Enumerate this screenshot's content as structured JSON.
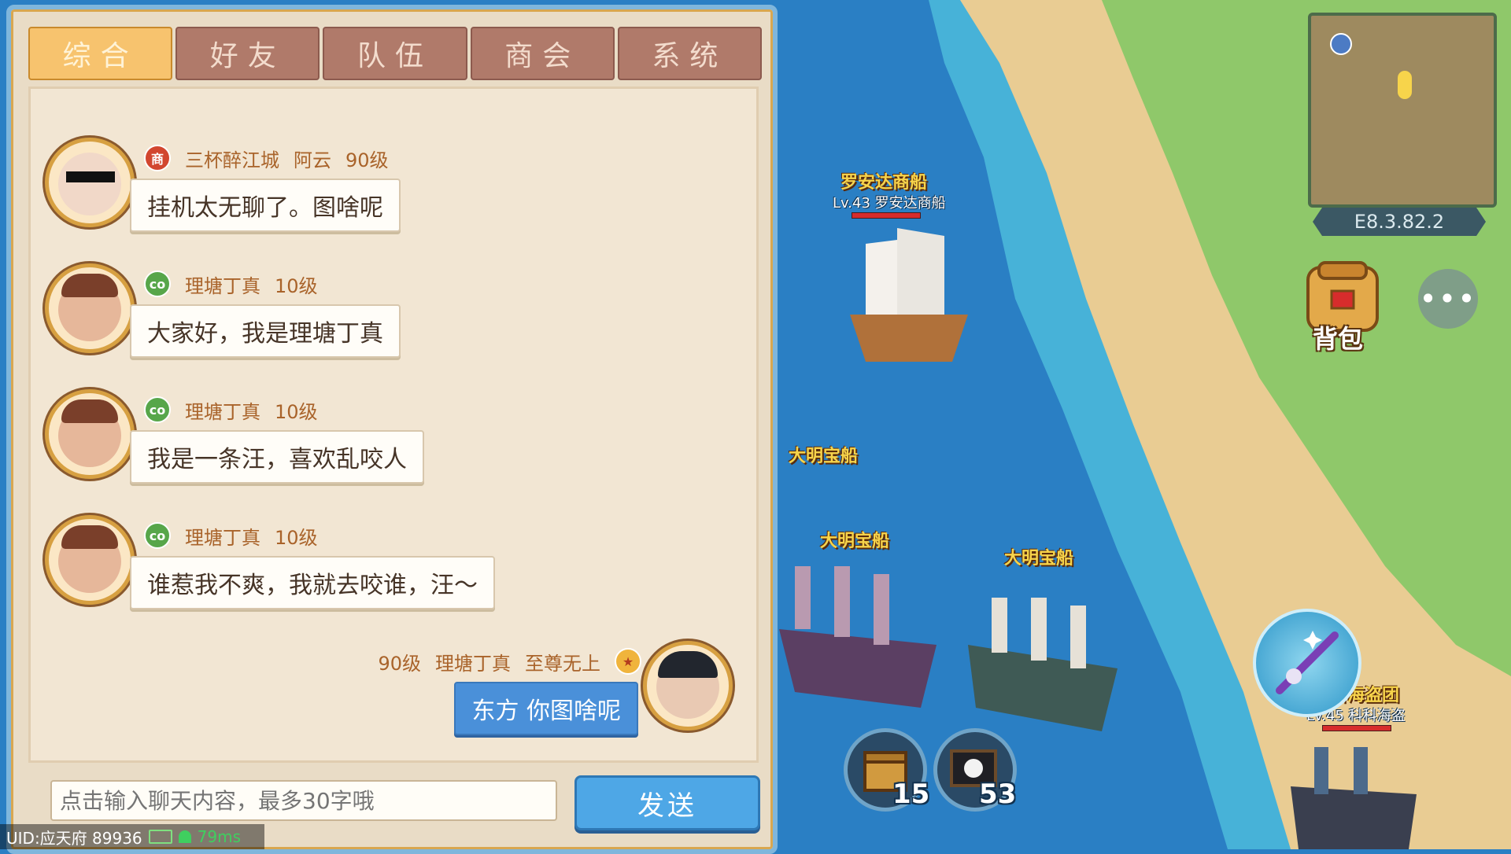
{
  "tabs": [
    {
      "label": "综合",
      "active": true
    },
    {
      "label": "好友",
      "active": false
    },
    {
      "label": "队伍",
      "active": false
    },
    {
      "label": "商会",
      "active": false
    },
    {
      "label": "系统",
      "active": false
    }
  ],
  "messages": [
    {
      "guild": "三杯醉江城",
      "name": "阿云",
      "level": "90级",
      "badge": "商",
      "text": "挂机太无聊了。图啥呢",
      "self": false
    },
    {
      "guild": "",
      "name": "理塘丁真",
      "level": "10级",
      "badge": "co",
      "text": "大家好，我是理塘丁真",
      "self": false
    },
    {
      "guild": "",
      "name": "理塘丁真",
      "level": "10级",
      "badge": "co",
      "text": "我是一条汪，喜欢乱咬人",
      "self": false
    },
    {
      "guild": "",
      "name": "理塘丁真",
      "level": "10级",
      "badge": "co",
      "text": "谁惹我不爽，我就去咬谁，汪～",
      "self": false
    },
    {
      "guild": "",
      "name": "理塘丁真",
      "level": "90级",
      "title": "至尊无上",
      "badge": "★",
      "text": "东方 你图啥呢",
      "self": true
    }
  ],
  "input": {
    "placeholder": "点击输入聊天内容，最多30字哦"
  },
  "send_label": "发送",
  "status": {
    "uid": "UID:应天府 89936",
    "ping": "79ms"
  },
  "minimap": {
    "coords": "E8.3.82.2"
  },
  "bag_label": "背包",
  "more_label": "•••",
  "resources": [
    {
      "icon": "crate-icon",
      "count": "15"
    },
    {
      "icon": "ghost-flag-icon",
      "count": "53"
    }
  ],
  "ships": [
    {
      "name": "罗安达商船",
      "sub": "Lv.43 罗安达商船"
    },
    {
      "name": "大明宝船",
      "sub": ""
    },
    {
      "name": "大明宝船",
      "sub": ""
    },
    {
      "name": "大明宝船",
      "sub": ""
    },
    {
      "name": "科科海盗团",
      "sub": "Lv.45 科科海盗"
    }
  ],
  "colors": {
    "sea": "#2a7fc4",
    "sand": "#e9cc93",
    "grass": "#8fc86a",
    "accent": "#f7c36e"
  }
}
